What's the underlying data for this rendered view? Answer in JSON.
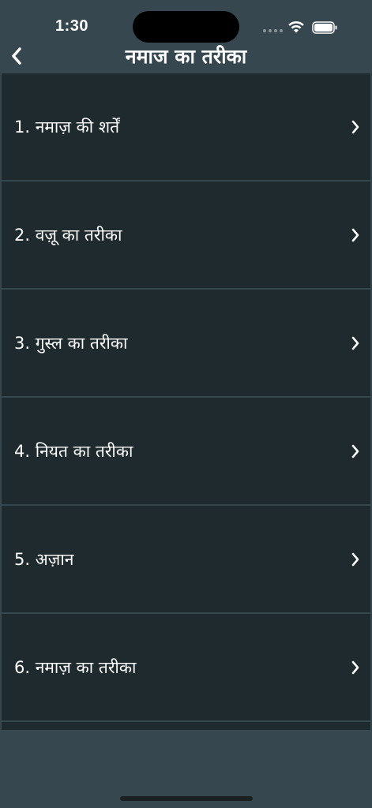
{
  "status_bar": {
    "time": "1:30"
  },
  "nav": {
    "title": "नमाज का तरीका"
  },
  "items": [
    {
      "label": "1. नमाज़ की शर्तें"
    },
    {
      "label": "2. वज़ू का तरीका"
    },
    {
      "label": "3. गुस्ल का तरीका"
    },
    {
      "label": "4. नियत का तरीका"
    },
    {
      "label": "5. अज़ान"
    },
    {
      "label": "6. नमाज़ का तरीका"
    }
  ],
  "colors": {
    "background": "#37474f",
    "list_background": "#1f2a2f",
    "divider": "#36474e",
    "text": "#ffffff"
  },
  "icons": {
    "back": "chevron-left-icon",
    "row": "chevron-right-icon",
    "wifi": "wifi-icon",
    "battery": "battery-icon"
  }
}
